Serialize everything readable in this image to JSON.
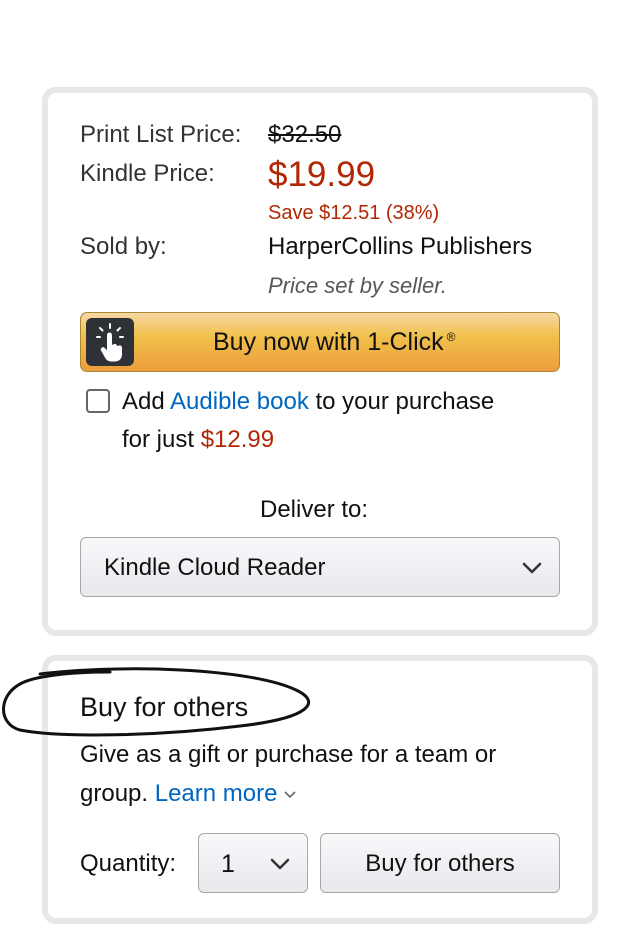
{
  "pricing": {
    "print_list_price_label": "Print List Price:",
    "print_list_price": "$32.50",
    "kindle_price_label": "Kindle Price:",
    "kindle_price": "$19.99",
    "savings": "Save $12.51 (38%)",
    "sold_by_label": "Sold by:",
    "seller": "HarperCollins Publishers",
    "price_note": "Price set by seller."
  },
  "one_click": {
    "label": "Buy now with 1-Click",
    "reg_mark": "®",
    "icon": "tap-finger-icon"
  },
  "audible": {
    "prefix": "Add ",
    "link": "Audible book",
    "suffix": " to your purchase",
    "line2_prefix": "for just ",
    "price": "$12.99"
  },
  "deliver": {
    "label": "Deliver to:",
    "selected": "Kindle Cloud Reader"
  },
  "others": {
    "title": "Buy for others",
    "desc_line1": "Give as a gift or purchase for a team or",
    "desc_line2_prefix": "group.",
    "learn_more": "Learn more",
    "quantity_label": "Quantity:",
    "quantity_value": "1",
    "button_label": "Buy for others"
  },
  "colors": {
    "price_red": "#B12704",
    "link_blue": "#0066c0",
    "button_orange": "#f0c14b"
  }
}
